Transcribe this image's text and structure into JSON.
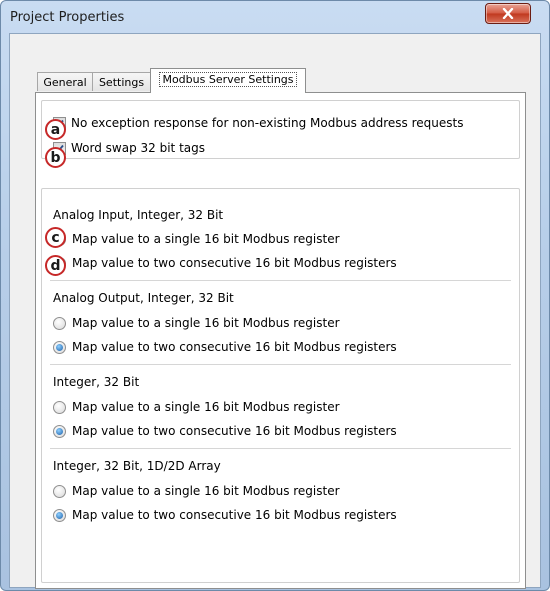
{
  "window": {
    "title": "Project Properties",
    "close_icon": "close-icon"
  },
  "tabs": [
    {
      "label": "General",
      "active": false
    },
    {
      "label": "Settings",
      "active": false
    },
    {
      "label": "Modbus Server Settings",
      "active": true
    }
  ],
  "options": {
    "no_exception": {
      "label": "No exception response for non-existing Modbus address requests",
      "checked": true,
      "badge": "a"
    },
    "word_swap": {
      "label": "Word swap 32 bit tags",
      "checked": true,
      "badge": "b"
    }
  },
  "sections": [
    {
      "title": "Analog Input, Integer, 32 Bit",
      "options": [
        {
          "label": "Map value to a single 16 bit Modbus register",
          "selected": false,
          "badge": "c"
        },
        {
          "label": "Map value to two consecutive 16 bit Modbus registers",
          "selected": true,
          "badge": "d"
        }
      ]
    },
    {
      "title": "Analog Output, Integer, 32 Bit",
      "options": [
        {
          "label": "Map value to a single 16 bit Modbus register",
          "selected": false
        },
        {
          "label": "Map value to two consecutive 16 bit Modbus registers",
          "selected": true
        }
      ]
    },
    {
      "title": "Integer, 32 Bit",
      "options": [
        {
          "label": "Map value to a single 16 bit Modbus register",
          "selected": false
        },
        {
          "label": "Map value to two consecutive 16 bit Modbus registers",
          "selected": true
        }
      ]
    },
    {
      "title": "Integer, 32 Bit, 1D/2D Array",
      "options": [
        {
          "label": "Map value to a single 16 bit Modbus register",
          "selected": false
        },
        {
          "label": "Map value to two consecutive 16 bit Modbus registers",
          "selected": true
        }
      ]
    }
  ],
  "colors": {
    "badge_ring": "#c62828",
    "radio_selected": "#1c5fa8",
    "close_button": "#c0391f"
  }
}
